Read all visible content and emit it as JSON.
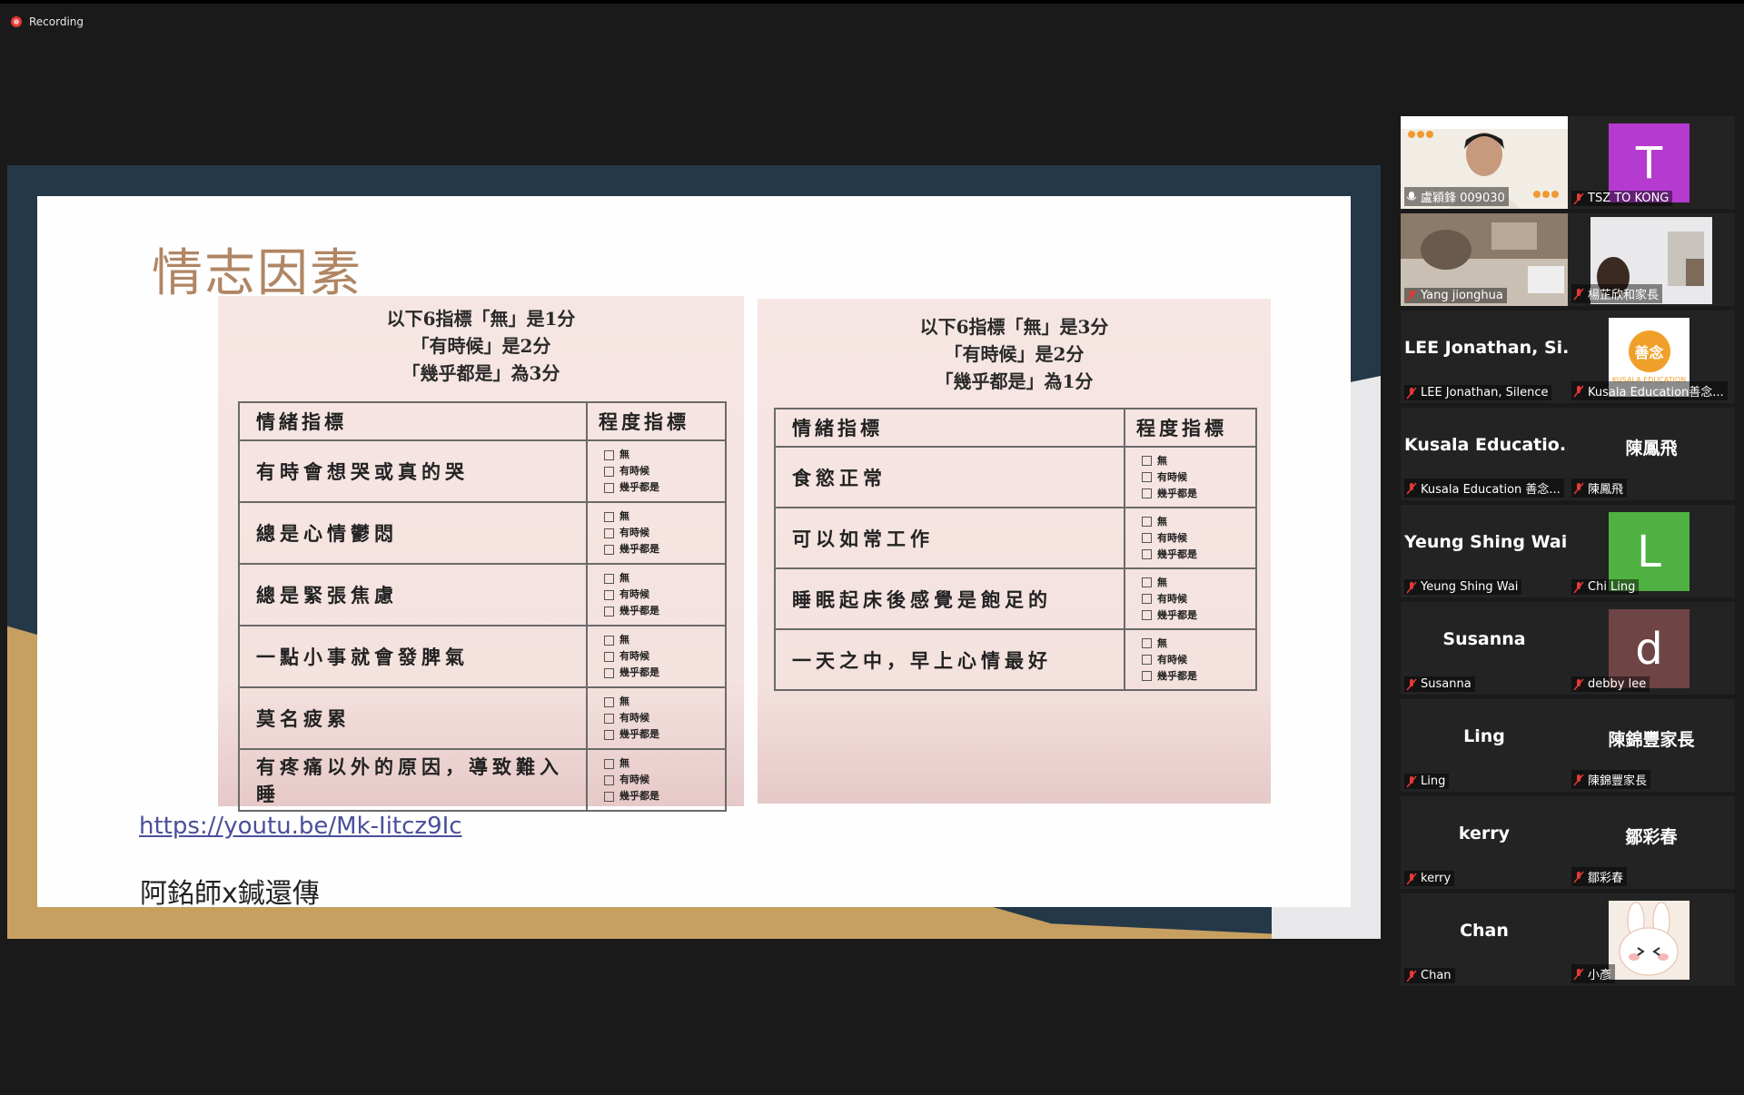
{
  "recording": {
    "label": "Recording"
  },
  "slide": {
    "title": "情志因素",
    "left_panel": {
      "instruction_lines": [
        "以下6指標「無」是1分",
        "「有時候」是2分",
        "「幾乎都是」為3分"
      ],
      "header": {
        "indicator": "情緒指標",
        "degree": "程度指標"
      },
      "rows": [
        "有時會想哭或真的哭",
        "總是心情鬱悶",
        "總是緊張焦慮",
        "一點小事就會發脾氣",
        "莫名疲累",
        "有疼痛以外的原因，導致難入睡"
      ]
    },
    "right_panel": {
      "instruction_lines": [
        "以下6指標「無」是3分",
        "「有時候」是2分",
        "「幾乎都是」為1分"
      ],
      "header": {
        "indicator": "情緒指標",
        "degree": "程度指標"
      },
      "rows": [
        "食慾正常",
        "可以如常工作",
        "睡眠起床後感覺是飽足的",
        "一天之中，早上心情最好"
      ]
    },
    "options": [
      "無",
      "有時候",
      "幾乎都是"
    ],
    "link": "https://youtu.be/Mk-Iitcz9Ic",
    "subtitle": "阿銘師x鍼還傳"
  },
  "gallery": {
    "tiles": [
      {
        "display": "",
        "label": "盧穎鋒 009030",
        "type": "video",
        "active": true
      },
      {
        "display": "T",
        "label": "TSZ TO KONG",
        "type": "avatar",
        "color": "#b53ad0"
      },
      {
        "display": "",
        "label": "Yang jionghua",
        "type": "video"
      },
      {
        "display": "",
        "label": "楊芷欣和家長",
        "type": "video"
      },
      {
        "display": "LEE Jonathan, Si...",
        "label": "LEE Jonathan, Silence",
        "type": "name"
      },
      {
        "display": "",
        "label": "Kusala Education善念...",
        "type": "logo"
      },
      {
        "display": "Kusala Educatio...",
        "label": "Kusala Education 善念...",
        "type": "name"
      },
      {
        "display": "陳鳳飛",
        "label": "陳鳳飛",
        "type": "name"
      },
      {
        "display": "Yeung Shing Wai",
        "label": "Yeung Shing Wai",
        "type": "name"
      },
      {
        "display": "L",
        "label": "Chi Ling",
        "type": "avatar",
        "color": "#4fb141"
      },
      {
        "display": "Susanna",
        "label": "Susanna",
        "type": "name"
      },
      {
        "display": "d",
        "label": "debby lee",
        "type": "avatar",
        "color": "#6e4445"
      },
      {
        "display": "Ling",
        "label": "Ling",
        "type": "name"
      },
      {
        "display": "陳錦豐家長",
        "label": "陳錦豐家長",
        "type": "name"
      },
      {
        "display": "kerry",
        "label": "kerry",
        "type": "name"
      },
      {
        "display": "鄒彩春",
        "label": "鄒彩春",
        "type": "name"
      },
      {
        "display": "Chan",
        "label": "Chan",
        "type": "name"
      },
      {
        "display": "",
        "label": "小彥",
        "type": "sticker"
      }
    ],
    "logo_text": {
      "top": "善念",
      "bottom": "KUSALA EDUCATION"
    }
  },
  "colors": {
    "slide_title": "#b08664",
    "panel_pink": "#f6e6e3",
    "active_speaker": "#d3e33c",
    "mic_muted": "#e53935"
  },
  "icons": [
    "recording-dot-icon",
    "mic-muted-icon",
    "checkbox-icon"
  ]
}
